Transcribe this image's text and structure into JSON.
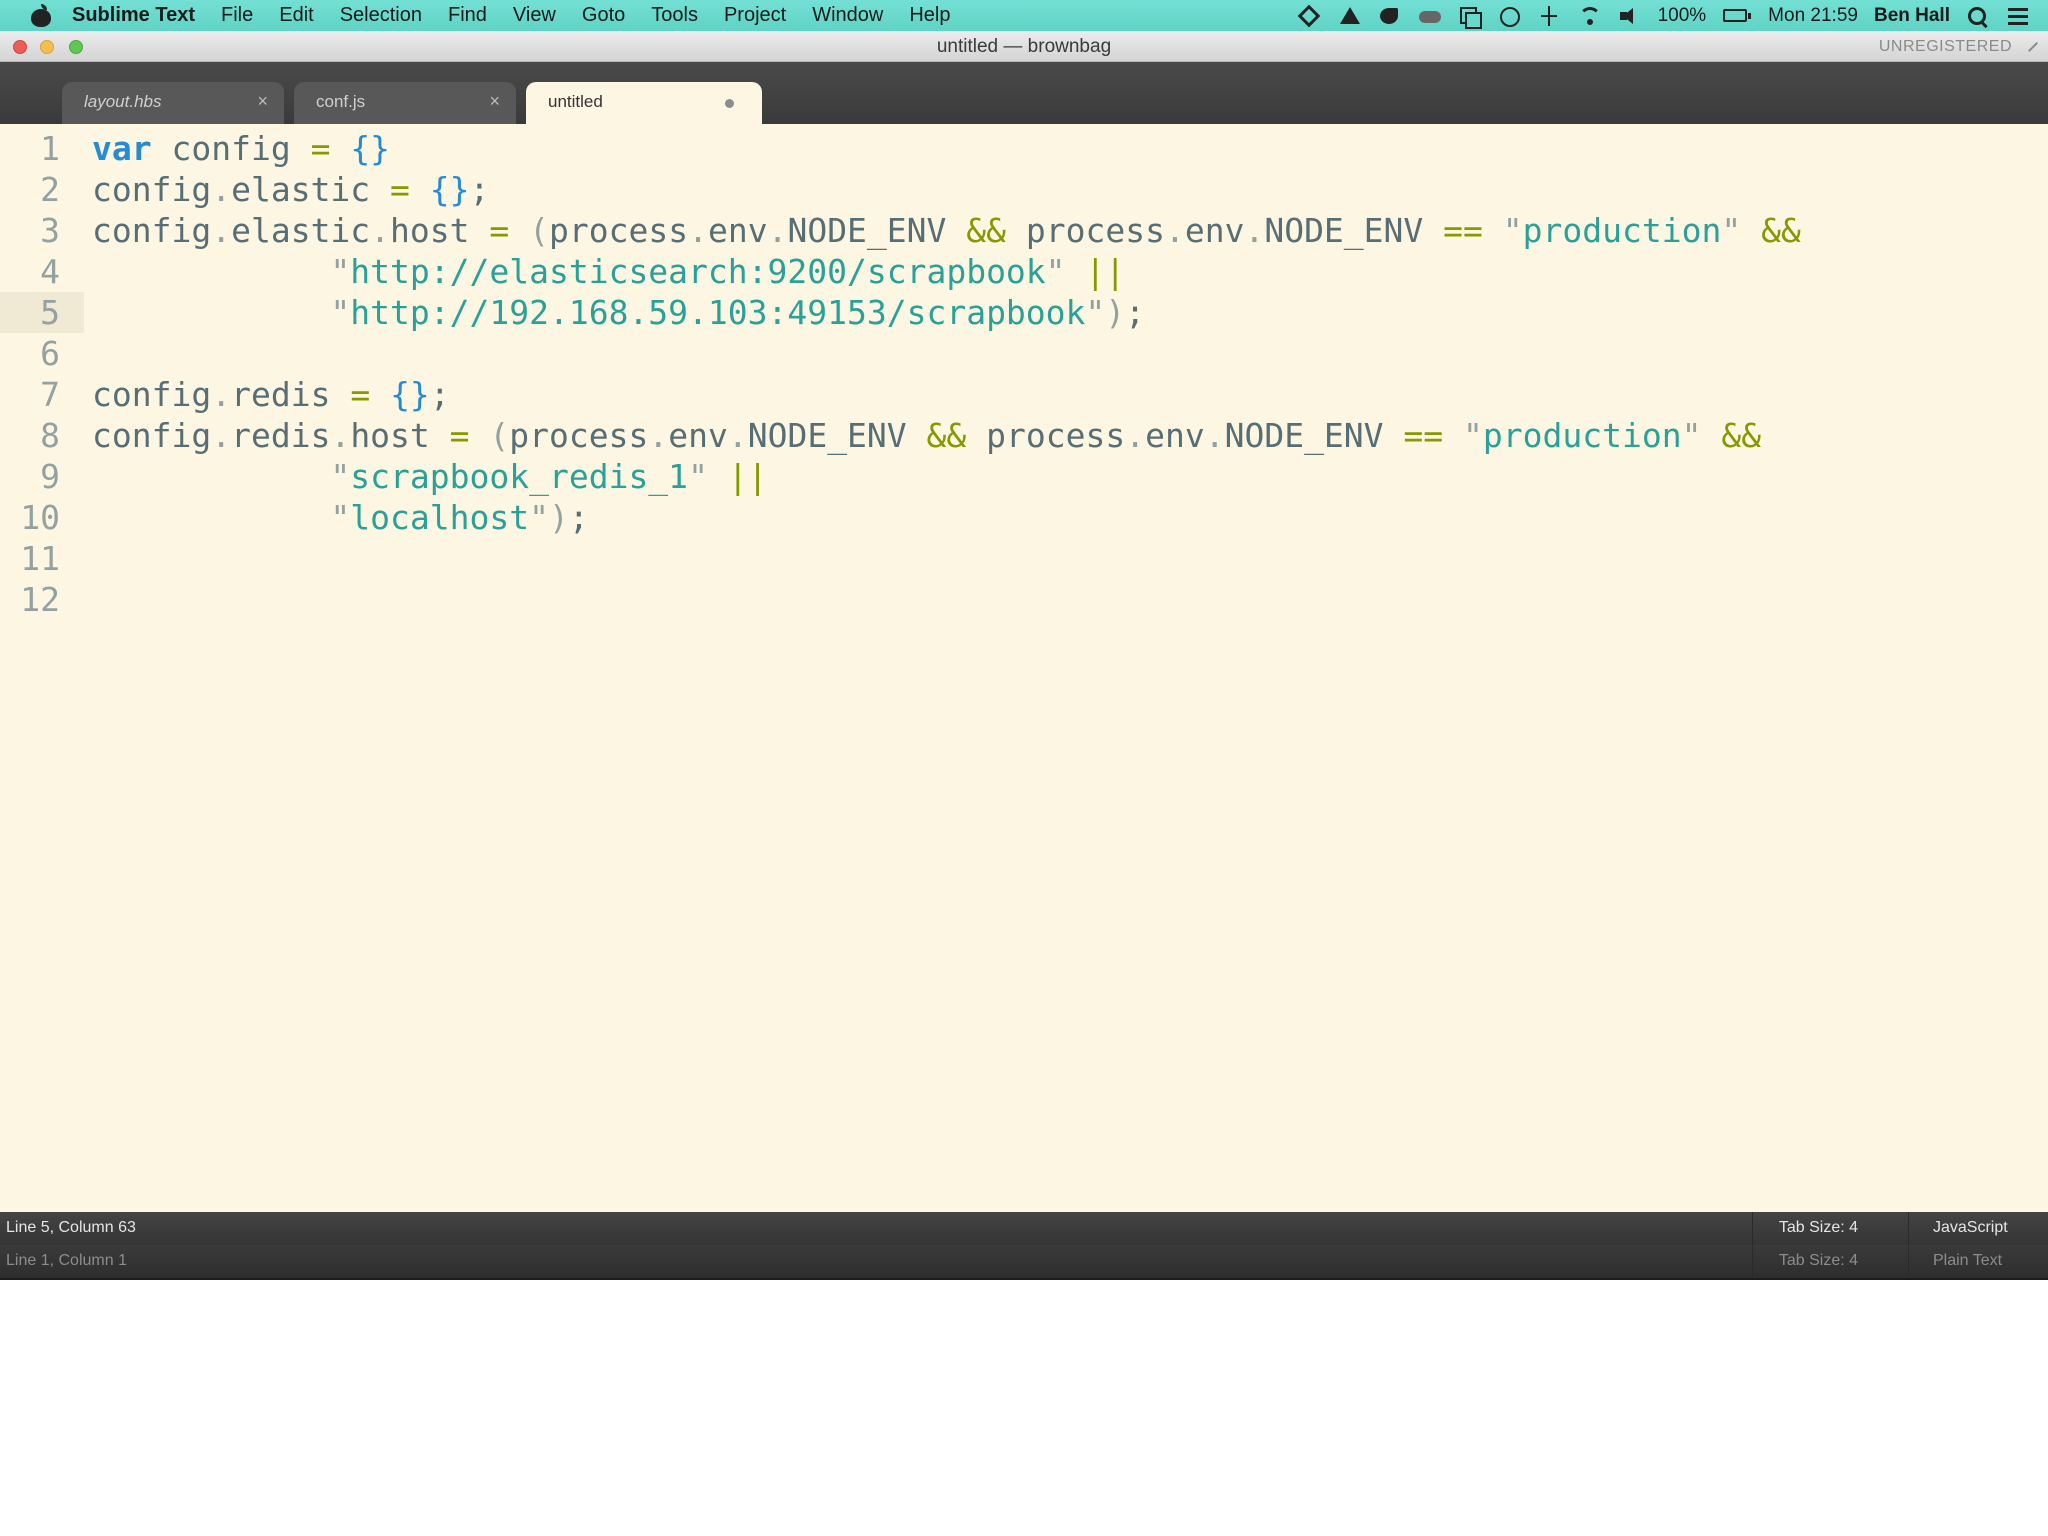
{
  "menubar": {
    "app_name": "Sublime Text",
    "menus": [
      "File",
      "Edit",
      "Selection",
      "Find",
      "View",
      "Goto",
      "Tools",
      "Project",
      "Window",
      "Help"
    ],
    "battery": "100%",
    "clock": "Mon 21:59",
    "user": "Ben Hall"
  },
  "window": {
    "title": "untitled — brownbag",
    "registration": "UNREGISTERED"
  },
  "tabs": [
    {
      "label": "layout.hbs",
      "active": false
    },
    {
      "label": "conf.js",
      "active": false
    },
    {
      "label": "untitled",
      "active": true,
      "dirty": true
    }
  ],
  "editor": {
    "current_line": 5,
    "lines": [
      {
        "n": "1",
        "tokens": [
          [
            "kw",
            "var"
          ],
          [
            "id",
            " config "
          ],
          [
            "op",
            "="
          ],
          [
            "id",
            " "
          ],
          [
            "brace",
            "{}"
          ]
        ]
      },
      {
        "n": "2",
        "tokens": [
          [
            "id",
            "config"
          ],
          [
            "punc",
            "."
          ],
          [
            "id",
            "elastic "
          ],
          [
            "op",
            "="
          ],
          [
            "id",
            " "
          ],
          [
            "brace",
            "{}"
          ],
          [
            "id",
            ";"
          ]
        ]
      },
      {
        "n": "3",
        "tokens": [
          [
            "id",
            "config"
          ],
          [
            "punc",
            "."
          ],
          [
            "id",
            "elastic"
          ],
          [
            "punc",
            "."
          ],
          [
            "id",
            "host "
          ],
          [
            "op",
            "="
          ],
          [
            "id",
            " "
          ],
          [
            "punc",
            "("
          ],
          [
            "id",
            "process"
          ],
          [
            "punc",
            "."
          ],
          [
            "id",
            "env"
          ],
          [
            "punc",
            "."
          ],
          [
            "id",
            "NODE_ENV "
          ],
          [
            "op",
            "&&"
          ],
          [
            "id",
            " process"
          ],
          [
            "punc",
            "."
          ],
          [
            "id",
            "env"
          ],
          [
            "punc",
            "."
          ],
          [
            "id",
            "NODE_ENV "
          ],
          [
            "op",
            "=="
          ],
          [
            "id",
            " "
          ],
          [
            "punc",
            "\""
          ],
          [
            "str",
            "production"
          ],
          [
            "punc",
            "\""
          ],
          [
            "id",
            " "
          ],
          [
            "op",
            "&&"
          ]
        ]
      },
      {
        "n": "4",
        "tokens": [
          [
            "id",
            "            "
          ],
          [
            "punc",
            "\""
          ],
          [
            "str",
            "http://elasticsearch:9200/scrapbook"
          ],
          [
            "punc",
            "\""
          ],
          [
            "id",
            " "
          ],
          [
            "op",
            "||"
          ]
        ]
      },
      {
        "n": "5",
        "tokens": [
          [
            "id",
            "            "
          ],
          [
            "punc",
            "\""
          ],
          [
            "str",
            "http://192.168.59.103:49153/scrapbook"
          ],
          [
            "punc",
            "\")"
          ],
          [
            "id",
            ";"
          ]
        ]
      },
      {
        "n": "6",
        "tokens": []
      },
      {
        "n": "7",
        "tokens": [
          [
            "id",
            "config"
          ],
          [
            "punc",
            "."
          ],
          [
            "id",
            "redis "
          ],
          [
            "op",
            "="
          ],
          [
            "id",
            " "
          ],
          [
            "brace",
            "{}"
          ],
          [
            "id",
            ";"
          ]
        ]
      },
      {
        "n": "8",
        "tokens": [
          [
            "id",
            "config"
          ],
          [
            "punc",
            "."
          ],
          [
            "id",
            "redis"
          ],
          [
            "punc",
            "."
          ],
          [
            "id",
            "host "
          ],
          [
            "op",
            "="
          ],
          [
            "id",
            " "
          ],
          [
            "punc",
            "("
          ],
          [
            "id",
            "process"
          ],
          [
            "punc",
            "."
          ],
          [
            "id",
            "env"
          ],
          [
            "punc",
            "."
          ],
          [
            "id",
            "NODE_ENV "
          ],
          [
            "op",
            "&&"
          ],
          [
            "id",
            " process"
          ],
          [
            "punc",
            "."
          ],
          [
            "id",
            "env"
          ],
          [
            "punc",
            "."
          ],
          [
            "id",
            "NODE_ENV "
          ],
          [
            "op",
            "=="
          ],
          [
            "id",
            " "
          ],
          [
            "punc",
            "\""
          ],
          [
            "str",
            "production"
          ],
          [
            "punc",
            "\""
          ],
          [
            "id",
            " "
          ],
          [
            "op",
            "&&"
          ]
        ]
      },
      {
        "n": "9",
        "tokens": [
          [
            "id",
            "            "
          ],
          [
            "punc",
            "\""
          ],
          [
            "str",
            "scrapbook_redis_1"
          ],
          [
            "punc",
            "\""
          ],
          [
            "id",
            " "
          ],
          [
            "op",
            "||"
          ]
        ]
      },
      {
        "n": "10",
        "tokens": [
          [
            "id",
            "            "
          ],
          [
            "punc",
            "\""
          ],
          [
            "str",
            "localhost"
          ],
          [
            "punc",
            "\")"
          ],
          [
            "id",
            ";"
          ]
        ]
      },
      {
        "n": "11",
        "tokens": []
      },
      {
        "n": "12",
        "tokens": []
      }
    ]
  },
  "statusbar": {
    "position": "Line 5, Column 63",
    "tab_size": "Tab Size: 4",
    "syntax": "JavaScript"
  },
  "statusbar_secondary": {
    "position": "Line 1, Column 1",
    "tab_size": "Tab Size: 4",
    "syntax": "Plain Text"
  }
}
